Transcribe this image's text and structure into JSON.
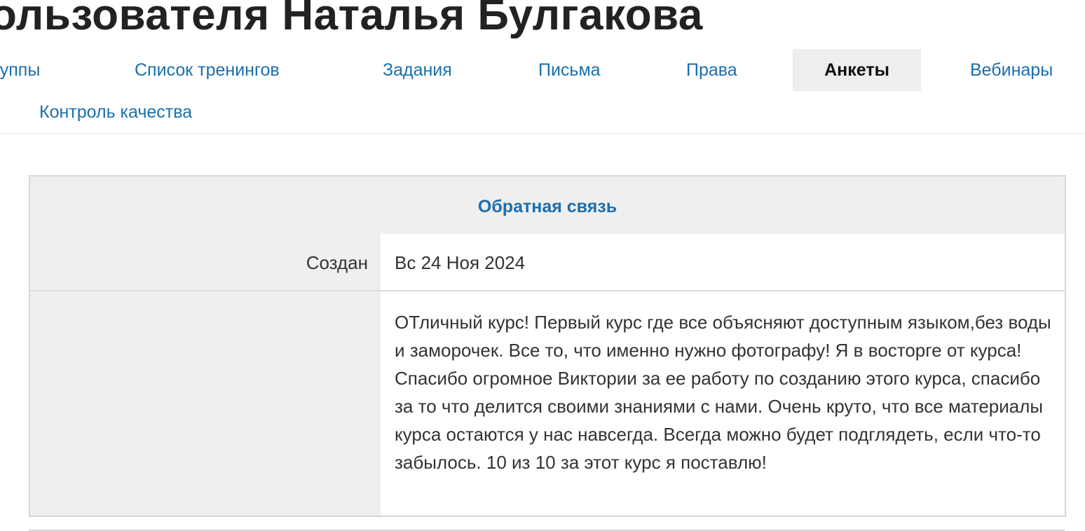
{
  "page": {
    "title": "ользователя Наталья Булгакова"
  },
  "tabs": [
    {
      "label": "Группы",
      "active": false
    },
    {
      "label": "Список тренингов",
      "active": false
    },
    {
      "label": "Задания",
      "active": false
    },
    {
      "label": "Письма",
      "active": false
    },
    {
      "label": "Права",
      "active": false
    },
    {
      "label": "Анкеты",
      "active": true
    },
    {
      "label": "Вебинары",
      "active": false
    },
    {
      "label": "Контроль качества",
      "active": false
    }
  ],
  "feedback": {
    "title": "Обратная связь",
    "created_label": "Создан",
    "created_value": "Вс 24 Ноя 2024",
    "comment_label": "",
    "comment_text": "ОТличный курс! Первый курс где все объясняют доступным языком,без воды и заморочек. Все то, что именно нужно фотографу! Я в восторге от курса! Спасибо огромное Виктории за ее работу по созданию этого курса, спасибо за то что делится своими знаниями с нами. Очень круто, что все материалы курса остаются у нас навсегда. Всегда можно будет подглядеть, если что-то забылось. 10 из 10 за этот курс я поставлю!"
  },
  "colors": {
    "link": "#1a6faf",
    "active_tab_bg": "#eeeeee",
    "card_bg": "#efefef"
  }
}
